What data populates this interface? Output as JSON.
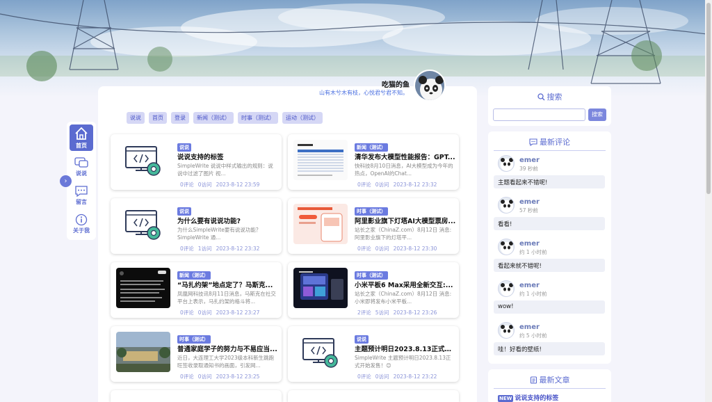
{
  "profile": {
    "name": "吃猫的鱼",
    "motto": "山有木兮木有枝，心悦君兮君不知。"
  },
  "nav_tabs": [
    "说说",
    "首页",
    "登录",
    "新闻（测试）",
    "时事（测试）",
    "运动（测试）"
  ],
  "side_nav": [
    {
      "label": "首页",
      "icon": "home-icon",
      "active": true
    },
    {
      "label": "说说",
      "icon": "chat-icon",
      "active": false
    },
    {
      "label": "留言",
      "icon": "message-icon",
      "active": false
    },
    {
      "label": "关于我",
      "icon": "info-icon",
      "active": false
    }
  ],
  "collapse_glyph": "›",
  "posts": [
    {
      "badge": "说说",
      "title": "说说支持的标签",
      "excerpt": "SimpleWrite 说说中样式输出的规则：说说中过滤了图片 视...",
      "meta_comments": "0评论",
      "meta_views": "0访问",
      "meta_date": "2023-8-12 23:59",
      "thumb": "code-icon"
    },
    {
      "badge": "新闻（测试）",
      "title": "清华发布大模型性能报告：GPT...",
      "excerpt": "快科技8月10日消息，AI大模型成为今年的热点，OpenAI的Chat...",
      "meta_comments": "0评论",
      "meta_views": "0访问",
      "meta_date": "2023-8-12 23:32",
      "thumb": "table-report"
    },
    {
      "badge": "说说",
      "title": "为什么要有说说功能?",
      "excerpt": "为什么SimpleWrite要有说说功能？SimpleWrite 通...",
      "meta_comments": "0评论",
      "meta_views": "1访问",
      "meta_date": "2023-8-12 23:32",
      "thumb": "code-icon"
    },
    {
      "badge": "时事（测试）",
      "title": "阿里影业旗下灯塔AI大模型票房...",
      "excerpt": "站长之家（ChinaZ.com）8月12日 消息:阿里影业旗下的灯塔平...",
      "meta_comments": "0评论",
      "meta_views": "0访问",
      "meta_date": "2023-8-12 23:30",
      "thumb": "phone-promo"
    },
    {
      "badge": "新闻（测试）",
      "title": "“马扎约架”地点定了？马斯克...",
      "excerpt": "凤凰网科技讯8月11日消息，马斯克在社交平台上表示，马扎约架的格斗将...",
      "meta_comments": "0评论",
      "meta_views": "0访问",
      "meta_date": "2023-8-12 23:27",
      "thumb": "dark-post"
    },
    {
      "badge": "时事（测试）",
      "title": "小米平板6 Max采用全新交互:...",
      "excerpt": "站长之家（ChinaZ.com）8月12日 消息:小米即将发布小米平板...",
      "meta_comments": "2评论",
      "meta_views": "5访问",
      "meta_date": "2023-8-12 23:26",
      "thumb": "tablet"
    },
    {
      "badge": "时事（测试）",
      "title": "普通家庭学子的努力与不易应当...",
      "excerpt": "近日，大连理工大学2023级本科新生跳跑旺签收录取通知书的画面，引发网...",
      "meta_comments": "0评论",
      "meta_views": "0访问",
      "meta_date": "2023-8-12 23:25",
      "thumb": "campus"
    },
    {
      "badge": "说说",
      "title": "主题预计明日2023.8.13正式开始...",
      "excerpt": "SimpleWrite 主题预计明日2023.8.13正式开始发售！😊",
      "meta_comments": "0评论",
      "meta_views": "0访问",
      "meta_date": "2023-8-12 23:22",
      "thumb": "code-icon"
    }
  ],
  "search": {
    "title": "搜索",
    "placeholder": "",
    "button": "搜索"
  },
  "comments": {
    "title": "最新评论",
    "items": [
      {
        "user": "emer",
        "time": "39 秒前",
        "body": "主题看起来不错呢!"
      },
      {
        "user": "emer",
        "time": "57 秒前",
        "body": "看看!"
      },
      {
        "user": "emer",
        "time": "约 1 小时前",
        "body": "看起来就不错呢!"
      },
      {
        "user": "emer",
        "time": "约 1 小时前",
        "body": "wow!"
      },
      {
        "user": "emer",
        "time": "约 5 小时前",
        "body": "哇！好看的壁纸!"
      }
    ]
  },
  "recent": {
    "title": "最新文章",
    "new_badge": "NEW",
    "first_item": "说说支持的标签"
  },
  "colors": {
    "accent": "#5b6bd0",
    "badge": "#6b7be0",
    "meta": "#8a93d8"
  }
}
